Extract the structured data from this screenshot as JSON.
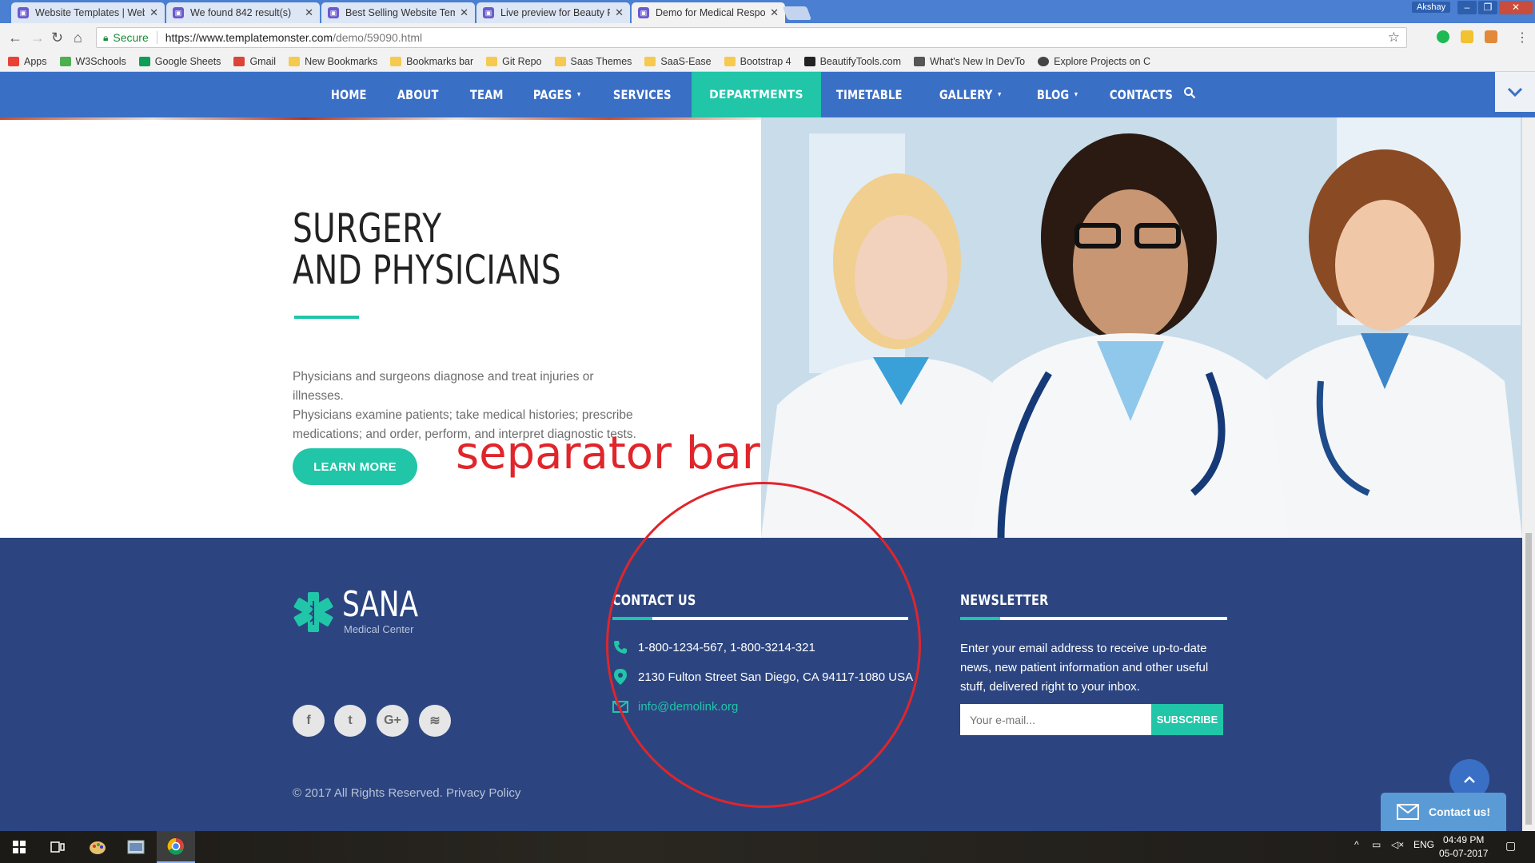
{
  "browser": {
    "tabs": [
      {
        "title": "Website Templates | Web",
        "active": false
      },
      {
        "title": "We found 842 result(s)",
        "active": false
      },
      {
        "title": "Best Selling Website Tem",
        "active": false
      },
      {
        "title": "Live preview for Beauty F",
        "active": false
      },
      {
        "title": "Demo for Medical Respo",
        "active": true
      }
    ],
    "user": "Akshay",
    "secure_label": "Secure",
    "url_host": "https://www.templatemonster.com",
    "url_path": "/demo/59090.html",
    "bookmarks": [
      {
        "label": "Apps",
        "color": "#e94235"
      },
      {
        "label": "W3Schools",
        "color": "#4caf50"
      },
      {
        "label": "Google Sheets",
        "color": "#0f9d58"
      },
      {
        "label": "Gmail",
        "color": "#db4437"
      },
      {
        "label": "New Bookmarks",
        "color": "#f6c94f"
      },
      {
        "label": "Bookmarks bar",
        "color": "#f6c94f"
      },
      {
        "label": "Git Repo",
        "color": "#f6c94f"
      },
      {
        "label": "Saas Themes",
        "color": "#f6c94f"
      },
      {
        "label": "SaaS-Ease",
        "color": "#f6c94f"
      },
      {
        "label": "Bootstrap 4",
        "color": "#f6c94f"
      },
      {
        "label": "BeautifyTools.com",
        "color": "#222222"
      },
      {
        "label": "What's New In DevTo",
        "color": "#555555"
      },
      {
        "label": "Explore Projects on C",
        "color": "#444444"
      }
    ]
  },
  "nav": {
    "items": [
      {
        "label": "HOME",
        "dropdown": false,
        "active": false
      },
      {
        "label": "ABOUT",
        "dropdown": false,
        "active": false
      },
      {
        "label": "TEAM",
        "dropdown": false,
        "active": false
      },
      {
        "label": "PAGES",
        "dropdown": true,
        "active": false
      },
      {
        "label": "SERVICES",
        "dropdown": false,
        "active": false
      },
      {
        "label": "DEPARTMENTS",
        "dropdown": false,
        "active": true
      },
      {
        "label": "TIMETABLE",
        "dropdown": false,
        "active": false
      },
      {
        "label": "GALLERY",
        "dropdown": true,
        "active": false
      },
      {
        "label": "BLOG",
        "dropdown": true,
        "active": false
      },
      {
        "label": "CONTACTS",
        "dropdown": false,
        "active": false
      }
    ]
  },
  "hero": {
    "title_line1": "SURGERY",
    "title_line2": "AND PHYSICIANS",
    "desc_line1": "Physicians and surgeons diagnose and treat injuries or illnesses.",
    "desc_line2": "Physicians examine patients; take medical histories; prescribe",
    "desc_line3": "medications; and order, perform, and interpret diagnostic tests.",
    "button": "LEARN MORE"
  },
  "annotation": {
    "text": "separator bar",
    "color": "#e0252b"
  },
  "footer": {
    "logo_name": "SANA",
    "logo_sub": "Medical Center",
    "social_icons": [
      "facebook-icon",
      "twitter-icon",
      "google-plus-icon",
      "rss-icon"
    ],
    "social_glyphs": [
      "f",
      "t",
      "G+",
      "≋"
    ],
    "copyright": "© 2017 All Rights Reserved. Privacy Policy",
    "contact": {
      "title": "CONTACT US",
      "phone": "1-800-1234-567, 1-800-3214-321",
      "address": "2130 Fulton Street San Diego, CA 94117-1080 USA",
      "email": "info@demolink.org"
    },
    "newsletter": {
      "title": "NEWSLETTER",
      "text": "Enter your email address to receive up-to-date news, new patient information and other useful stuff, delivered right to your inbox.",
      "placeholder": "Your e-mail...",
      "button": "SUBSCRIBE"
    },
    "contact_widget": "Contact us!"
  },
  "taskbar": {
    "lang": "ENG",
    "time": "04:49 PM",
    "date": "05-07-2017"
  },
  "colors": {
    "nav": "#3a6fc6",
    "accent": "#21c5a8",
    "footer": "#2c4580"
  }
}
